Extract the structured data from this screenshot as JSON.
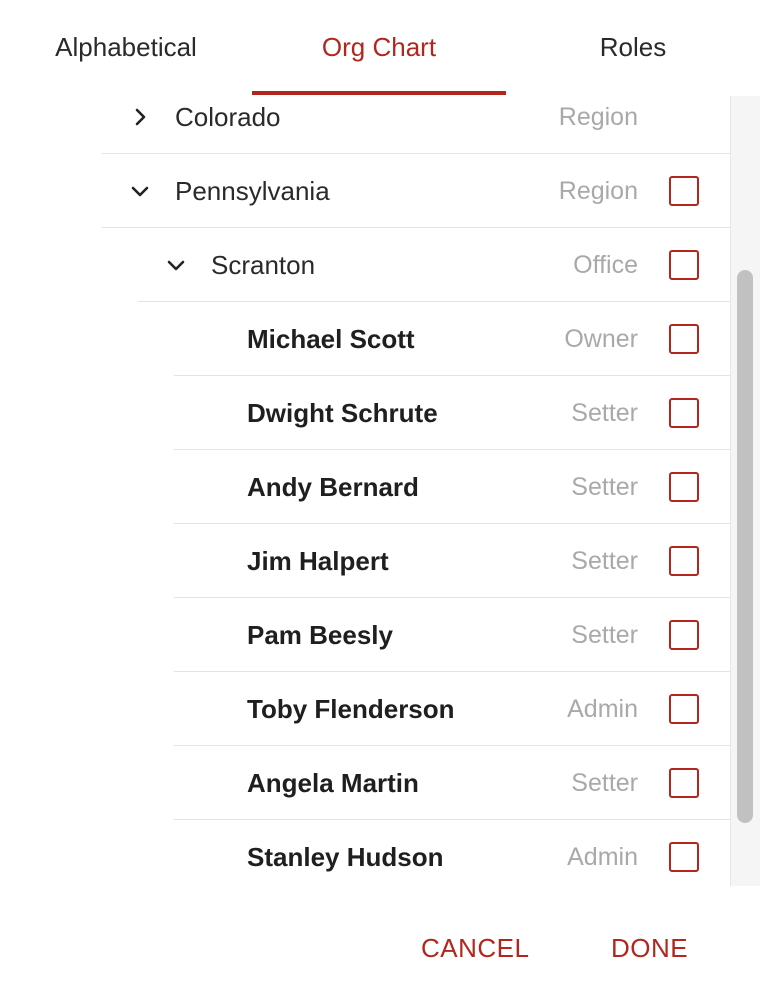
{
  "tabs": [
    {
      "label": "Alphabetical",
      "active": false
    },
    {
      "label": "Org Chart",
      "active": true
    },
    {
      "label": "Roles",
      "active": false
    }
  ],
  "colors": {
    "accent": "#b3261e",
    "muted_text": "#a9a9a9",
    "divider": "#e3e3e3"
  },
  "tree": [
    {
      "name": "Colorado",
      "type": "Region",
      "expanded": false,
      "checkbox": false
    },
    {
      "name": "Pennsylvania",
      "type": "Region",
      "expanded": true,
      "checkbox": true,
      "checked": false
    },
    {
      "name": "Scranton",
      "type": "Office",
      "expanded": true,
      "checkbox": true,
      "checked": false
    },
    {
      "name": "Michael Scott",
      "type": "Owner",
      "checked": false
    },
    {
      "name": "Dwight Schrute",
      "type": "Setter",
      "checked": false
    },
    {
      "name": "Andy Bernard",
      "type": "Setter",
      "checked": false
    },
    {
      "name": "Jim Halpert",
      "type": "Setter",
      "checked": false
    },
    {
      "name": "Pam Beesly",
      "type": "Setter",
      "checked": false
    },
    {
      "name": "Toby Flenderson",
      "type": "Admin",
      "checked": false
    },
    {
      "name": "Angela Martin",
      "type": "Setter",
      "checked": false
    },
    {
      "name": "Stanley Hudson",
      "type": "Admin",
      "checked": false
    }
  ],
  "icons": {
    "collapsed": "chevron-right-icon",
    "expanded": "chevron-down-icon"
  },
  "footer": {
    "cancel_label": "Cancel",
    "done_label": "Done"
  }
}
